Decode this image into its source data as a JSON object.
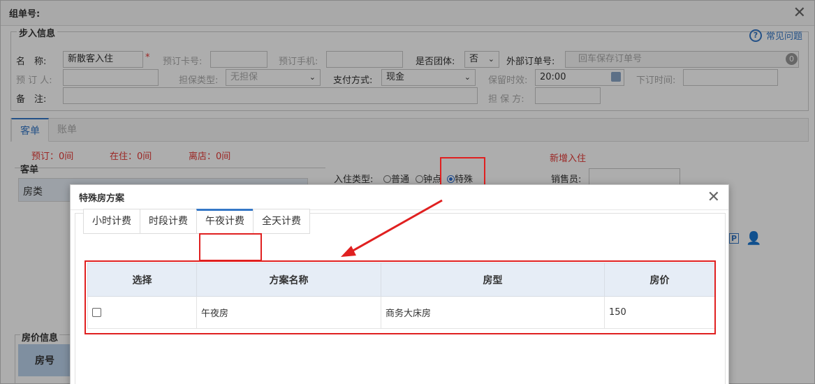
{
  "main": {
    "title": "组单号:",
    "legend": "步入信息",
    "help_label": "常见问题",
    "fields": {
      "name_label": "名　称:",
      "name_value": "新散客入住",
      "booking_card_label": "预订卡号:",
      "booking_phone_label": "预订手机:",
      "group_label": "是否团体:",
      "group_value": "否",
      "external_order_label": "外部订单号:",
      "external_order_placeholder": "回车保存订单号",
      "booker_label": "预 订 人:",
      "guarantee_type_label": "担保类型:",
      "guarantee_type_value": "无担保",
      "payment_label": "支付方式:",
      "payment_value": "现金",
      "hold_time_label": "保留时效:",
      "hold_time_value": "20:00",
      "order_time_label": "下订时间:",
      "guarantor_label": "担 保 方:",
      "remark_label": "备　注:"
    },
    "tabs": [
      {
        "label": "客单"
      },
      {
        "label": "账单"
      }
    ],
    "status": {
      "reserved": "预订：0间",
      "staying": "在住：0间",
      "left": "离店：0间",
      "new_checkin": "新增入住"
    },
    "section_guest": "客单",
    "grid_col_room_type": "房类",
    "checkin_type_label": "入住类型:",
    "checkin_options": [
      "普通",
      "钟点",
      "特殊"
    ],
    "checkin_selected": 2,
    "salesperson_label": "销售员:",
    "section_rate": "房价信息",
    "rate_col_room_no": "房号"
  },
  "modal": {
    "title": "特殊房方案",
    "tabs": [
      "小时计费",
      "时段计费",
      "午夜计费",
      "全天计费"
    ],
    "active_tab": 2,
    "columns": [
      "选择",
      "方案名称",
      "房型",
      "房价"
    ],
    "rows": [
      {
        "name": "午夜房",
        "room_type": "商务大床房",
        "price": "150"
      }
    ]
  },
  "colors": {
    "accent": "#3578c7",
    "highlight": "#e02020",
    "header_bg": "#e6edf6"
  }
}
